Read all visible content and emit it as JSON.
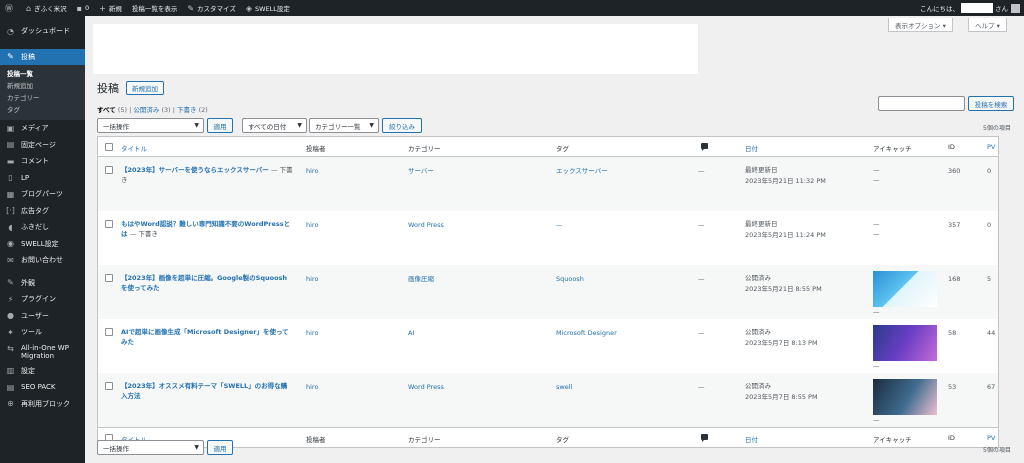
{
  "admin_bar": {
    "site_name": "ぎふく米沢",
    "comments_count": "0",
    "new": "新規",
    "view_posts": "投稿一覧を表示",
    "customize": "カスタマイズ",
    "swell_settings": "SWELL設定",
    "greeting_prefix": "こんにちは、",
    "greeting_suffix": "さん"
  },
  "sidebar": {
    "dashboard": "ダッシュボード",
    "posts": "投稿",
    "sub": [
      "投稿一覧",
      "新規追加",
      "カテゴリー",
      "タグ"
    ],
    "media": "メディア",
    "pages": "固定ページ",
    "comments": "コメント",
    "lp": "LP",
    "blog_parts": "ブログパーツ",
    "ad_tags": "広告タグ",
    "fukidashi": "ふきだし",
    "swell_settings": "SWELL設定",
    "contact": "お問い合わせ",
    "appearance": "外観",
    "plugins": "プラグイン",
    "users": "ユーザー",
    "tools": "ツール",
    "aio": "All-in-One WP Migration",
    "settings": "設定",
    "seo_pack": "SEO PACK",
    "reusable_blocks": "再利用ブロック"
  },
  "screen_options": "表示オプション ▾",
  "help": "ヘルプ ▾",
  "page_title": "投稿",
  "add_new": "新規追加",
  "views": {
    "all": "すべて",
    "all_count": "(5)",
    "published": "公開済み",
    "published_count": "(3)",
    "drafts": "下書き",
    "drafts_count": "(2)"
  },
  "search_button": "投稿を検索",
  "bulk_action": "一括操作",
  "apply": "適用",
  "all_dates": "すべての日付",
  "all_categories": "カテゴリー一覧",
  "filter": "絞り込み",
  "items_count": "5個の項目",
  "columns": {
    "title": "タイトル",
    "author": "投稿者",
    "categories": "カテゴリー",
    "tags": "タグ",
    "date": "日付",
    "eyecatch": "アイキャッチ",
    "id": "ID",
    "pv": "PV"
  },
  "posts": [
    {
      "title": "【2023年】サーバーを使うならエックスサーバー",
      "state": "— 下書き",
      "author": "hiro",
      "category": "サーバー",
      "tag": "エックスサーバー",
      "comments": "—",
      "date_status": "最終更新日",
      "date": "2023年5月21日 11:32 PM",
      "thumb": "—\n—",
      "id": "360",
      "pv": "0"
    },
    {
      "title": "もはやWord認説？難しい専門知識不要のWordPressとは",
      "state": "— 下書き",
      "author": "hiro",
      "category": "Word Press",
      "tag": "—",
      "comments": "—",
      "date_status": "最終更新日",
      "date": "2023年5月21日 11:24 PM",
      "thumb": "—\n—",
      "id": "357",
      "pv": "0"
    },
    {
      "title": "【2023年】画像を超単に圧縮。Google製のSquooshを使ってみた",
      "state": "",
      "author": "hiro",
      "category": "画像圧縮",
      "tag": "Squoosh",
      "comments": "—",
      "date_status": "公開済み",
      "date": "2023年5月21日 8:55 PM",
      "thumb": "—",
      "id": "168",
      "pv": "5"
    },
    {
      "title": "AIで超単に画像生成「Microsoft Designer」を使ってみた",
      "state": "",
      "author": "hiro",
      "category": "AI",
      "tag": "Microsoft Designer",
      "comments": "—",
      "date_status": "公開済み",
      "date": "2023年5月7日 8:13 PM",
      "thumb": "—",
      "id": "58",
      "pv": "44"
    },
    {
      "title": "【2023年】オススメ有料テーマ「SWELL」のお得な購入方法",
      "state": "",
      "author": "hiro",
      "category": "Word Press",
      "tag": "swell",
      "comments": "—",
      "date_status": "公開済み",
      "date": "2023年5月7日 8:55 PM",
      "thumb": "—",
      "id": "53",
      "pv": "67"
    }
  ],
  "colors": {
    "admin_dark": "#1d2327",
    "accent": "#2271b1",
    "link": "#2271b1"
  }
}
